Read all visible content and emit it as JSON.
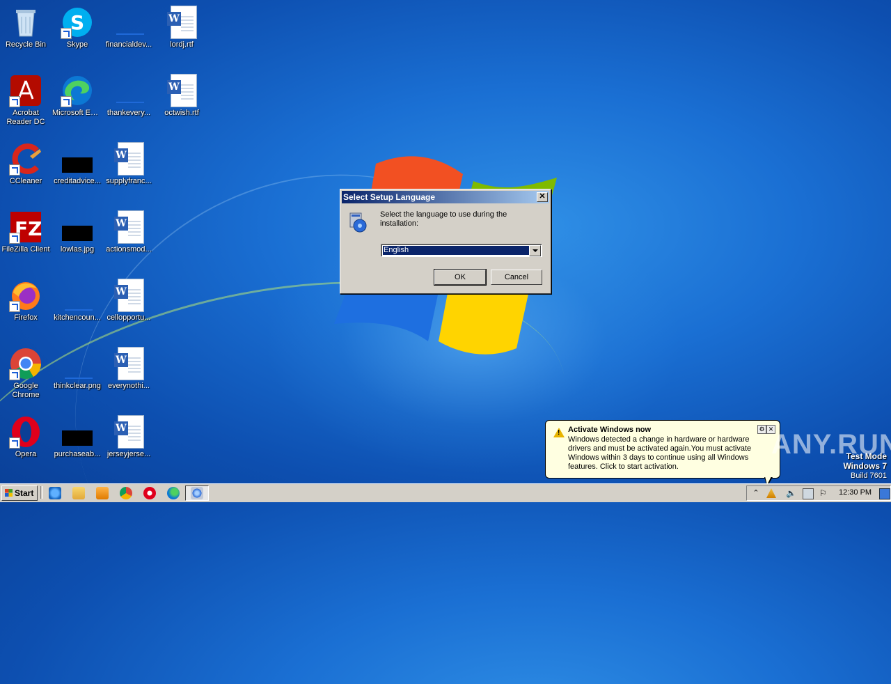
{
  "desktop": {
    "icons": [
      {
        "label": "Recycle Bin"
      },
      {
        "label": "Skype"
      },
      {
        "label": "financialdev..."
      },
      {
        "label": "lordj.rtf"
      },
      {
        "label": "Acrobat Reader DC"
      },
      {
        "label": "Microsoft Edge"
      },
      {
        "label": "thankevery..."
      },
      {
        "label": "octwish.rtf"
      },
      {
        "label": "CCleaner"
      },
      {
        "label": "creditadvice..."
      },
      {
        "label": "supplyfranc..."
      },
      {
        "label": "FileZilla Client"
      },
      {
        "label": "lowlas.jpg"
      },
      {
        "label": "actionsmod..."
      },
      {
        "label": "Firefox"
      },
      {
        "label": "kitchencoun..."
      },
      {
        "label": "cellopportu..."
      },
      {
        "label": "Google Chrome"
      },
      {
        "label": "thinkclear.png"
      },
      {
        "label": "everynothi..."
      },
      {
        "label": "Opera"
      },
      {
        "label": "purchaseab..."
      },
      {
        "label": "jerseyjerse..."
      }
    ]
  },
  "dialog": {
    "title": "Select Setup Language",
    "message": "Select the language to use during the installation:",
    "language_value": "English",
    "ok_label": "OK",
    "cancel_label": "Cancel"
  },
  "balloon": {
    "title": "Activate Windows now",
    "body": "Windows detected a change in hardware or hardware drivers and must be activated again.You must activate Windows within 3 days to continue using all Windows features. Click to start activation."
  },
  "watermark": "ANY.RUN",
  "testmode": {
    "line1": "Test Mode",
    "line2": "Windows 7",
    "line3": "Build 7601"
  },
  "taskbar": {
    "start_label": "Start",
    "clock": "12:30 PM"
  }
}
